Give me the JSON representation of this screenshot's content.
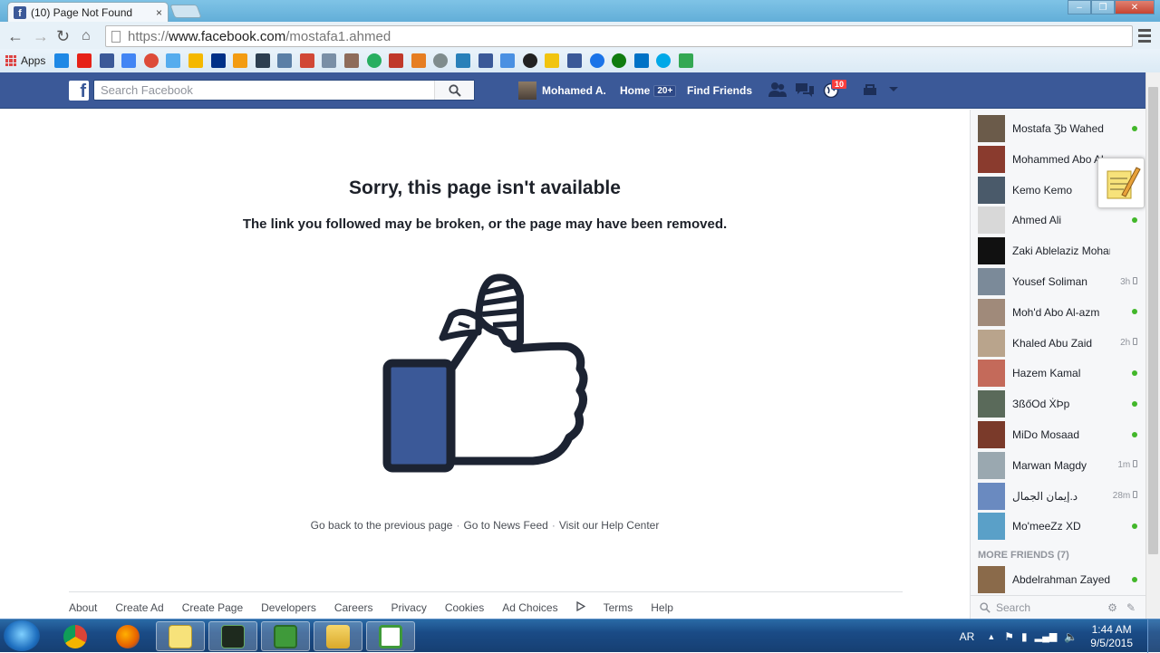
{
  "browser": {
    "tab_title": "(10) Page Not Found",
    "tab_close": "×",
    "url_scheme": "https://",
    "url_host": "www.facebook.com",
    "url_path": "/mostafa1.ahmed",
    "apps_label": "Apps",
    "window_controls": [
      "–",
      "❐",
      "✕"
    ]
  },
  "fb_header": {
    "search_placeholder": "Search Facebook",
    "user_name": "Mohamed A.",
    "home_label": "Home",
    "home_badge": "20+",
    "find_friends_label": "Find Friends",
    "notification_count": "10",
    "brand_color": "#3b5998"
  },
  "error": {
    "title": "Sorry, this page isn't available",
    "subtitle": "The link you followed may be broken, or the page may have been removed.",
    "links": [
      "Go back to the previous page",
      "Go to News Feed",
      "Visit our Help Center"
    ],
    "link_separator": "·"
  },
  "footer": {
    "links": [
      "About",
      "Create Ad",
      "Create Page",
      "Developers",
      "Careers",
      "Privacy",
      "Cookies",
      "Ad Choices",
      "Terms",
      "Help"
    ]
  },
  "chat": {
    "contacts": [
      {
        "name": "Mostafa Ʒb Wahed",
        "status": "online",
        "time": ""
      },
      {
        "name": "Mohammed Abo Al",
        "status": "",
        "time": ""
      },
      {
        "name": "Kemo Kemo",
        "status": "",
        "time": ""
      },
      {
        "name": "Ahmed Ali",
        "status": "online",
        "time": ""
      },
      {
        "name": "Zaki Ablelaziz Mohamed",
        "status": "",
        "time": ""
      },
      {
        "name": "Yousef Soliman",
        "status": "mobile",
        "time": "3h"
      },
      {
        "name": "Moh'd Abo Al-azm",
        "status": "online",
        "time": ""
      },
      {
        "name": "Khaled Abu Zaid",
        "status": "mobile",
        "time": "2h"
      },
      {
        "name": "Hazem Kamal",
        "status": "online",
        "time": ""
      },
      {
        "name": "ЗßőOd ẊÞp",
        "status": "online",
        "time": ""
      },
      {
        "name": "MiDo Mosaad",
        "status": "online",
        "time": ""
      },
      {
        "name": "Marwan Magdy",
        "status": "mobile",
        "time": "1m"
      },
      {
        "name": "د.إيمان الجمال",
        "status": "mobile",
        "time": "28m"
      },
      {
        "name": "Mo'meeZz XD",
        "status": "online",
        "time": ""
      }
    ],
    "more_friends_label": "MORE FRIENDS (7)",
    "more_contacts": [
      {
        "name": "Abdelrahman Zayed",
        "status": "online",
        "time": ""
      }
    ],
    "search_placeholder": "Search",
    "online_color": "#42b72a"
  },
  "taskbar": {
    "language": "AR",
    "time": "1:44 AM",
    "date": "9/5/2015"
  }
}
